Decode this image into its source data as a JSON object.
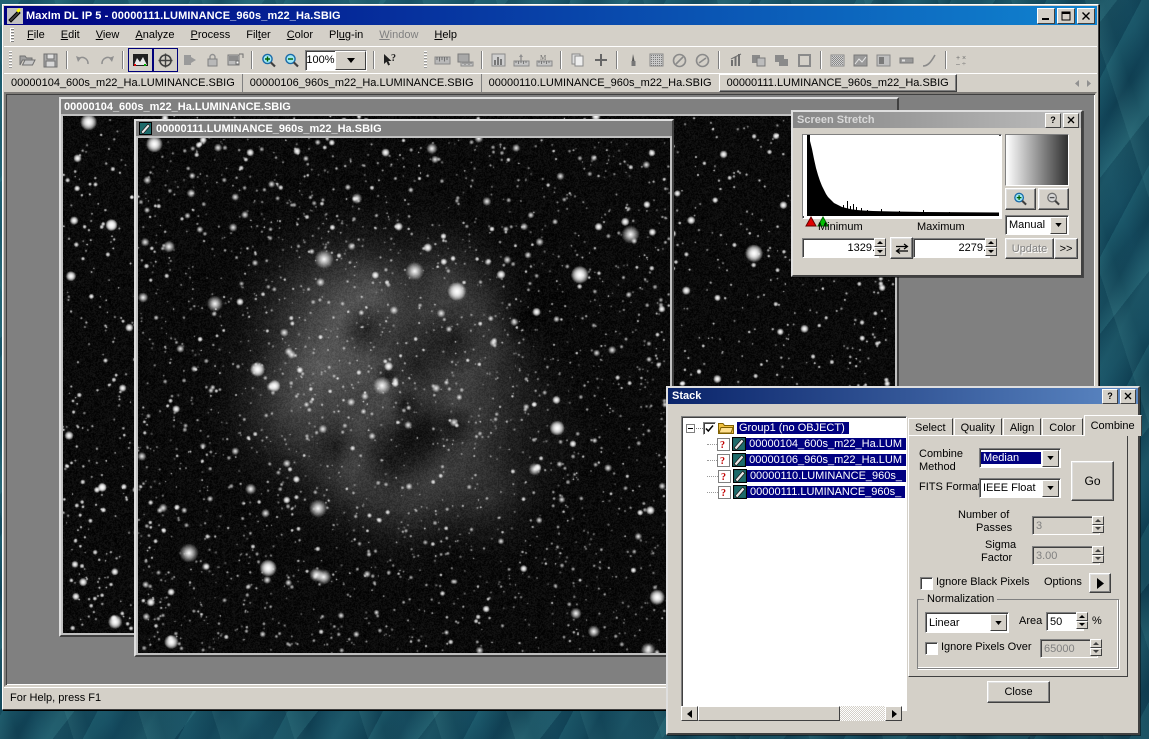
{
  "app": {
    "title": "MaxIm DL IP 5 - 00000111.LUMINANCE_960s_m22_Ha.SBIG",
    "window_buttons": [
      "minimize",
      "maximize",
      "close"
    ]
  },
  "menu": {
    "items": [
      {
        "label": "File",
        "disabled": false
      },
      {
        "label": "Edit",
        "disabled": false
      },
      {
        "label": "View",
        "disabled": false
      },
      {
        "label": "Analyze",
        "disabled": false
      },
      {
        "label": "Process",
        "disabled": false
      },
      {
        "label": "Filter",
        "disabled": false
      },
      {
        "label": "Color",
        "disabled": false
      },
      {
        "label": "Plug-in",
        "disabled": false
      },
      {
        "label": "Window",
        "disabled": true
      },
      {
        "label": "Help",
        "disabled": false
      }
    ]
  },
  "toolbar": {
    "zoom_value": "100%",
    "groups": [
      [
        "open-icon",
        "save-icon"
      ],
      [
        "undo-icon",
        "redo-icon"
      ],
      [
        "screen-stretch-icon",
        "crosshair-icon",
        "fit-icon",
        "lock-icon",
        "batch-icon"
      ],
      [
        "zoom-in-icon",
        "zoom-out-icon"
      ],
      [
        "zoom-combo"
      ],
      [
        "help-pointer-icon"
      ],
      [
        "ruler-icon",
        "calibrate-icon"
      ],
      [
        "histogram-tool-icon",
        "measure-icon",
        "magnitude-icon"
      ],
      [
        "copy-icon",
        "plus-icon"
      ],
      [
        "pixel-probe-icon",
        "noise-icon",
        "half-circle-icon",
        "contrast-icon"
      ],
      [
        "graph-icon",
        "overlay-icon",
        "layers-icon",
        "square-icon"
      ],
      [
        "flat-icon",
        "dark-icon",
        "bias-icon",
        "strip-icon",
        "curve-icon"
      ],
      [
        "calc-icon"
      ]
    ]
  },
  "document_tabs": {
    "items": [
      {
        "label": "00000104_600s_m22_Ha.LUMINANCE.SBIG",
        "active": false
      },
      {
        "label": "00000106_960s_m22_Ha.LUMINANCE.SBIG",
        "active": false
      },
      {
        "label": "00000110.LUMINANCE_960s_m22_Ha.SBIG",
        "active": false
      },
      {
        "label": "00000111.LUMINANCE_960s_m22_Ha.SBIG",
        "active": true
      }
    ]
  },
  "image_windows": [
    {
      "title": "00000104_600s_m22_Ha.LUMINANCE.SBIG",
      "active": false
    },
    {
      "title": "00000111.LUMINANCE_960s_m22_Ha.SBIG",
      "active": true
    }
  ],
  "screen_stretch": {
    "title": "Screen Stretch",
    "help_button": "?",
    "close_button": "×",
    "minimum_label": "Minimum",
    "maximum_label": "Maximum",
    "minimum_value": "1329.",
    "maximum_value": "2279.",
    "mode": "Manual",
    "update_label": "Update",
    "more_label": ">>",
    "swap_icon": "swap-icon",
    "zoom_in_icon": "zoom-in-icon",
    "zoom_out_icon": "zoom-out-icon"
  },
  "stack": {
    "title": "Stack",
    "help_button": "?",
    "close_button": "×",
    "tree": {
      "group_label": "Group1 (no OBJECT)",
      "files": [
        "00000104_600s_m22_Ha.LUM",
        "00000106_960s_m22_Ha.LUM",
        "00000110.LUMINANCE_960s_",
        "00000111.LUMINANCE_960s_"
      ]
    },
    "tabs": [
      {
        "label": "Select",
        "active": false
      },
      {
        "label": "Quality",
        "active": false
      },
      {
        "label": "Align",
        "active": false
      },
      {
        "label": "Color",
        "active": false
      },
      {
        "label": "Combine",
        "active": true
      }
    ],
    "combine": {
      "combine_method_label_1": "Combine",
      "combine_method_label_2": "Method",
      "combine_method_value": "Median",
      "fits_format_label": "FITS Format",
      "fits_format_value": "IEEE Float",
      "number_of_passes_label_1": "Number of",
      "number_of_passes_label_2": "Passes",
      "number_of_passes_value": "3",
      "sigma_factor_label_1": "Sigma",
      "sigma_factor_label_2": "Factor",
      "sigma_factor_value": "3.00",
      "ignore_black_pixels_label": "Ignore Black Pixels",
      "ignore_black_pixels_checked": false,
      "options_label": "Options",
      "go_label": "Go",
      "normalization_label": "Normalization",
      "normalization_value": "Linear",
      "area_label": "Area",
      "area_value": "50",
      "percent_label": "%",
      "ignore_pixels_over_label": "Ignore Pixels Over",
      "ignore_pixels_over_checked": false,
      "ignore_pixels_over_value": "65000",
      "close_label": "Close"
    }
  },
  "statusbar": {
    "message": "For Help, press F1"
  },
  "colors": {
    "face": "#d4d0c8",
    "title_active": "#000080",
    "title_inactive": "#808080",
    "selection": "#000080",
    "mdi_back": "#808080",
    "desktop": "#12475a"
  }
}
